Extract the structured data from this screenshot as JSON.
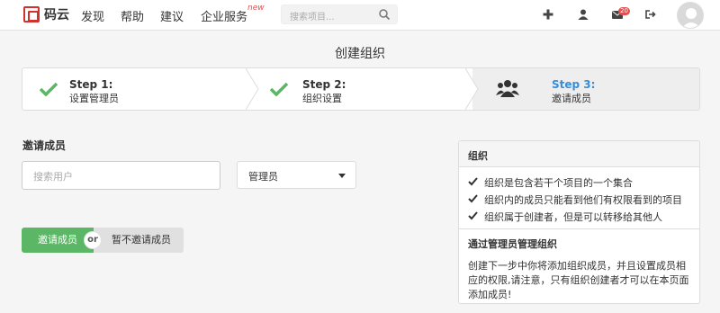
{
  "header": {
    "logo_text": "码云",
    "nav": [
      "发现",
      "帮助",
      "建议",
      "企业服务"
    ],
    "nav_new_badge": "new",
    "search_placeholder": "搜索项目...",
    "mail_count": "20"
  },
  "page_title": "创建组织",
  "steps": [
    {
      "title": "Step 1:",
      "subtitle": "设置管理员",
      "status": "done"
    },
    {
      "title": "Step 2:",
      "subtitle": "组织设置",
      "status": "done"
    },
    {
      "title": "Step 3:",
      "subtitle": "邀请成员",
      "status": "active"
    }
  ],
  "form": {
    "section_label": "邀请成员",
    "user_search_placeholder": "搜索用户",
    "role_selected": "管理员",
    "invite_button": "邀请成员",
    "or_label": "or",
    "skip_button": "暂不邀请成员"
  },
  "panel": {
    "title": "组织",
    "items": [
      "组织是包含若干个项目的一个集合",
      "组织内的成员只能看到他们有权限看到的项目",
      "组织属于创建者，但是可以转移给其他人"
    ],
    "subtitle": "通过管理员管理组织",
    "description": "创建下一步中你将添加组织成员，并且设置成员相应的权限,请注意，只有组织创建者才可以在本页面添加成员!"
  },
  "colors": {
    "accent_green": "#5bb765",
    "active_blue": "#3b8cd6",
    "brand_red": "#d2322d"
  }
}
